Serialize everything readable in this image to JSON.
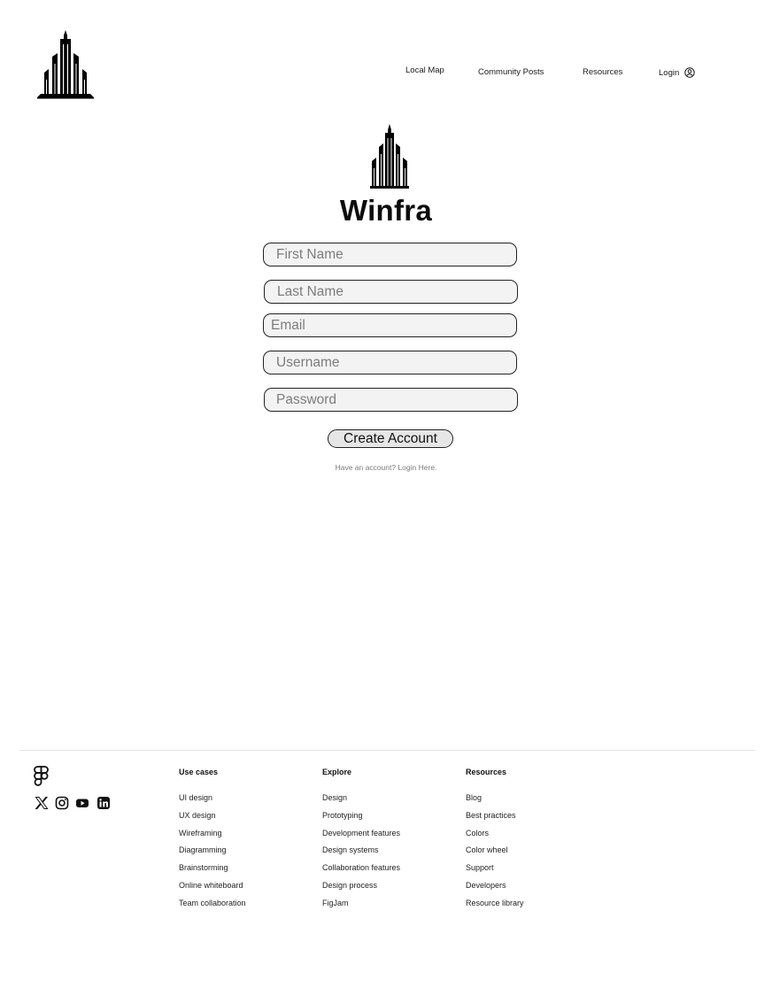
{
  "brand": {
    "name": "Winfra",
    "logo_icon": "skyscraper-logo-icon"
  },
  "nav": {
    "items": [
      "Local Map",
      "Community Posts",
      "Resources",
      "Login"
    ],
    "login_icon": "user-circle-icon"
  },
  "form": {
    "first_name_placeholder": "First Name",
    "last_name_placeholder": "Last Name",
    "email_placeholder": "Email",
    "username_placeholder": "Username",
    "password_placeholder": "Password",
    "submit_label": "Create Account",
    "login_prompt": "Have an account? Login Here."
  },
  "footer": {
    "logo_icon": "figma-logo-icon",
    "social_icons": [
      "x-icon",
      "instagram-icon",
      "youtube-icon",
      "linkedin-icon"
    ],
    "columns": [
      {
        "title": "Use cases",
        "links": [
          "UI design",
          "UX design",
          "Wireframing",
          "Diagramming",
          "Brainstorming",
          "Online whiteboard",
          "Team collaboration"
        ]
      },
      {
        "title": "Explore",
        "links": [
          "Design",
          "Prototyping",
          "Development features",
          "Design systems",
          "Collaboration features",
          "Design process",
          "FigJam"
        ]
      },
      {
        "title": "Resources",
        "links": [
          "Blog",
          "Best practices",
          "Colors",
          "Color wheel",
          "Support",
          "Developers",
          "Resource library"
        ]
      }
    ]
  },
  "colors": {
    "text": "#111111",
    "field_bg": "#f3f3f3",
    "button_bg": "#e6e6e6",
    "muted": "#7a7a7a"
  }
}
